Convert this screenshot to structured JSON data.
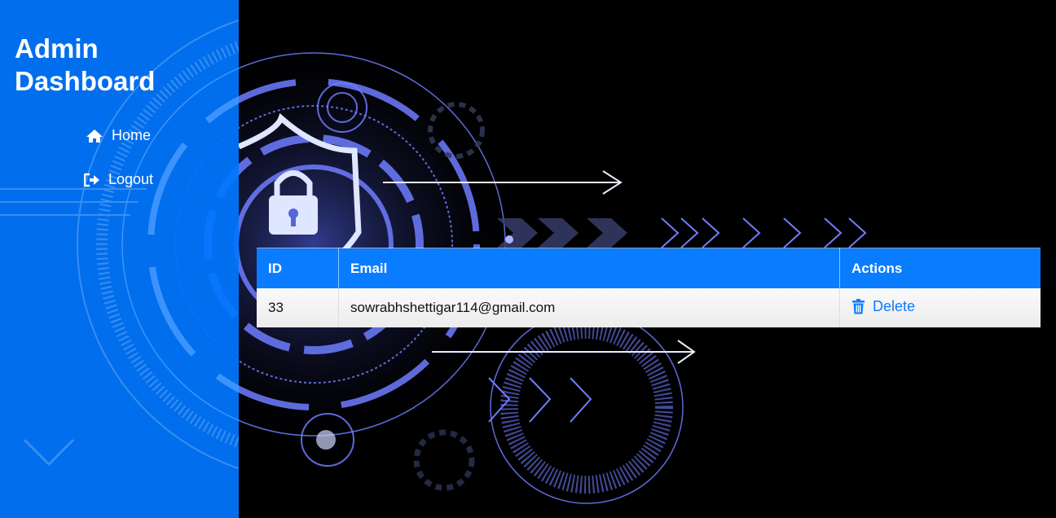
{
  "sidebar": {
    "title": "Admin Dashboard",
    "items": [
      {
        "label": "Home",
        "icon": "home-icon"
      },
      {
        "label": "Logout",
        "icon": "logout-icon"
      }
    ]
  },
  "table": {
    "headers": [
      "ID",
      "Email",
      "Actions"
    ],
    "rows": [
      {
        "id": "33",
        "email": "sowrabhshettigar114@gmail.com",
        "action_label": "Delete",
        "action_icon": "trash-icon"
      }
    ]
  },
  "colors": {
    "accent": "#0a7cff",
    "background": "#000000",
    "row_background": "#f4f4f4"
  }
}
